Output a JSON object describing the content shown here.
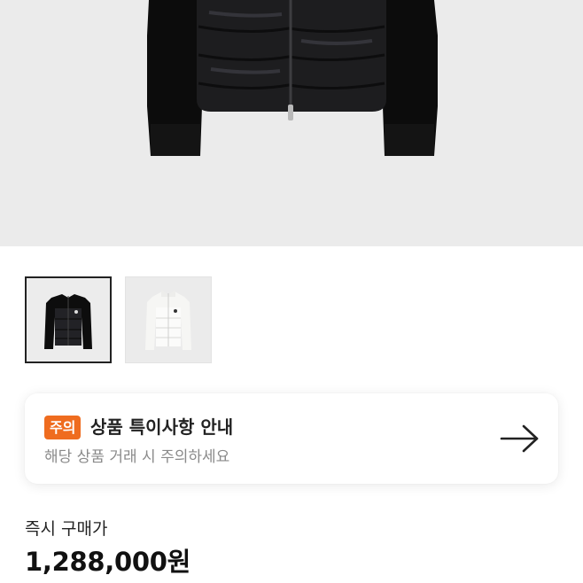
{
  "product": {
    "main_image": "black-padded-jacket-photo",
    "thumbnails": [
      {
        "image": "black-jacket-thumbnail",
        "selected": true
      },
      {
        "image": "white-jacket-thumbnail",
        "selected": false
      }
    ]
  },
  "notice": {
    "badge": "주의",
    "title": "상품 특이사항 안내",
    "subtitle": "해당 상품 거래 시 주의하세요",
    "arrow_icon": "arrow-right-icon",
    "badge_color": "#ef6c1f"
  },
  "price": {
    "label": "즉시 구매가",
    "value": "1,288,000원"
  }
}
